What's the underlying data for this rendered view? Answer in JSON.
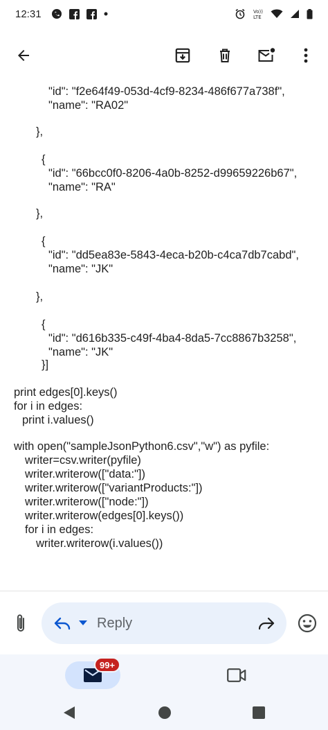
{
  "status_bar": {
    "time": "12:31",
    "network_label": "Vo)) LTE"
  },
  "email_body": {
    "lines": [
      "\"id\": \"f2e64f49-053d-4cf9-8234-486f677a738f\",",
      "\"name\": \"RA02\"",
      "},",
      "{",
      "\"id\": \"66bcc0f0-8206-4a0b-8252-d99659226b67\",",
      "\"name\": \"RA\"",
      "},",
      "{",
      "\"id\": \"dd5ea83e-5843-4eca-b20b-c4ca7db7cabd\",",
      "\"name\": \"JK\"",
      "},",
      "{",
      "\"id\": \"d616b335-c49f-4ba4-8da5-7cc8867b3258\",",
      "\"name\": \"JK\"",
      "}]",
      "print edges[0].keys()",
      "for i in edges:",
      "print i.values()",
      "with open(\"sampleJsonPython6.csv\",\"w\") as pyfile:",
      "writer=csv.writer(pyfile)",
      "writer.writerow([\"data:\"])",
      "writer.writerow([\"variantProducts:\"])",
      "writer.writerow([\"node:\"])",
      "writer.writerow(edges[0].keys())",
      "for i in edges:",
      "writer.writerow(i.values())"
    ]
  },
  "reply_bar": {
    "reply_label": "Reply"
  },
  "bottom_nav": {
    "mail_badge": "99+"
  },
  "colors": {
    "accent": "#0b57d0",
    "badge": "#c5221f",
    "reply_pill": "#eaf1fb",
    "mail_tab": "#d3e3fd",
    "nav_bg": "#f3f6fc"
  }
}
